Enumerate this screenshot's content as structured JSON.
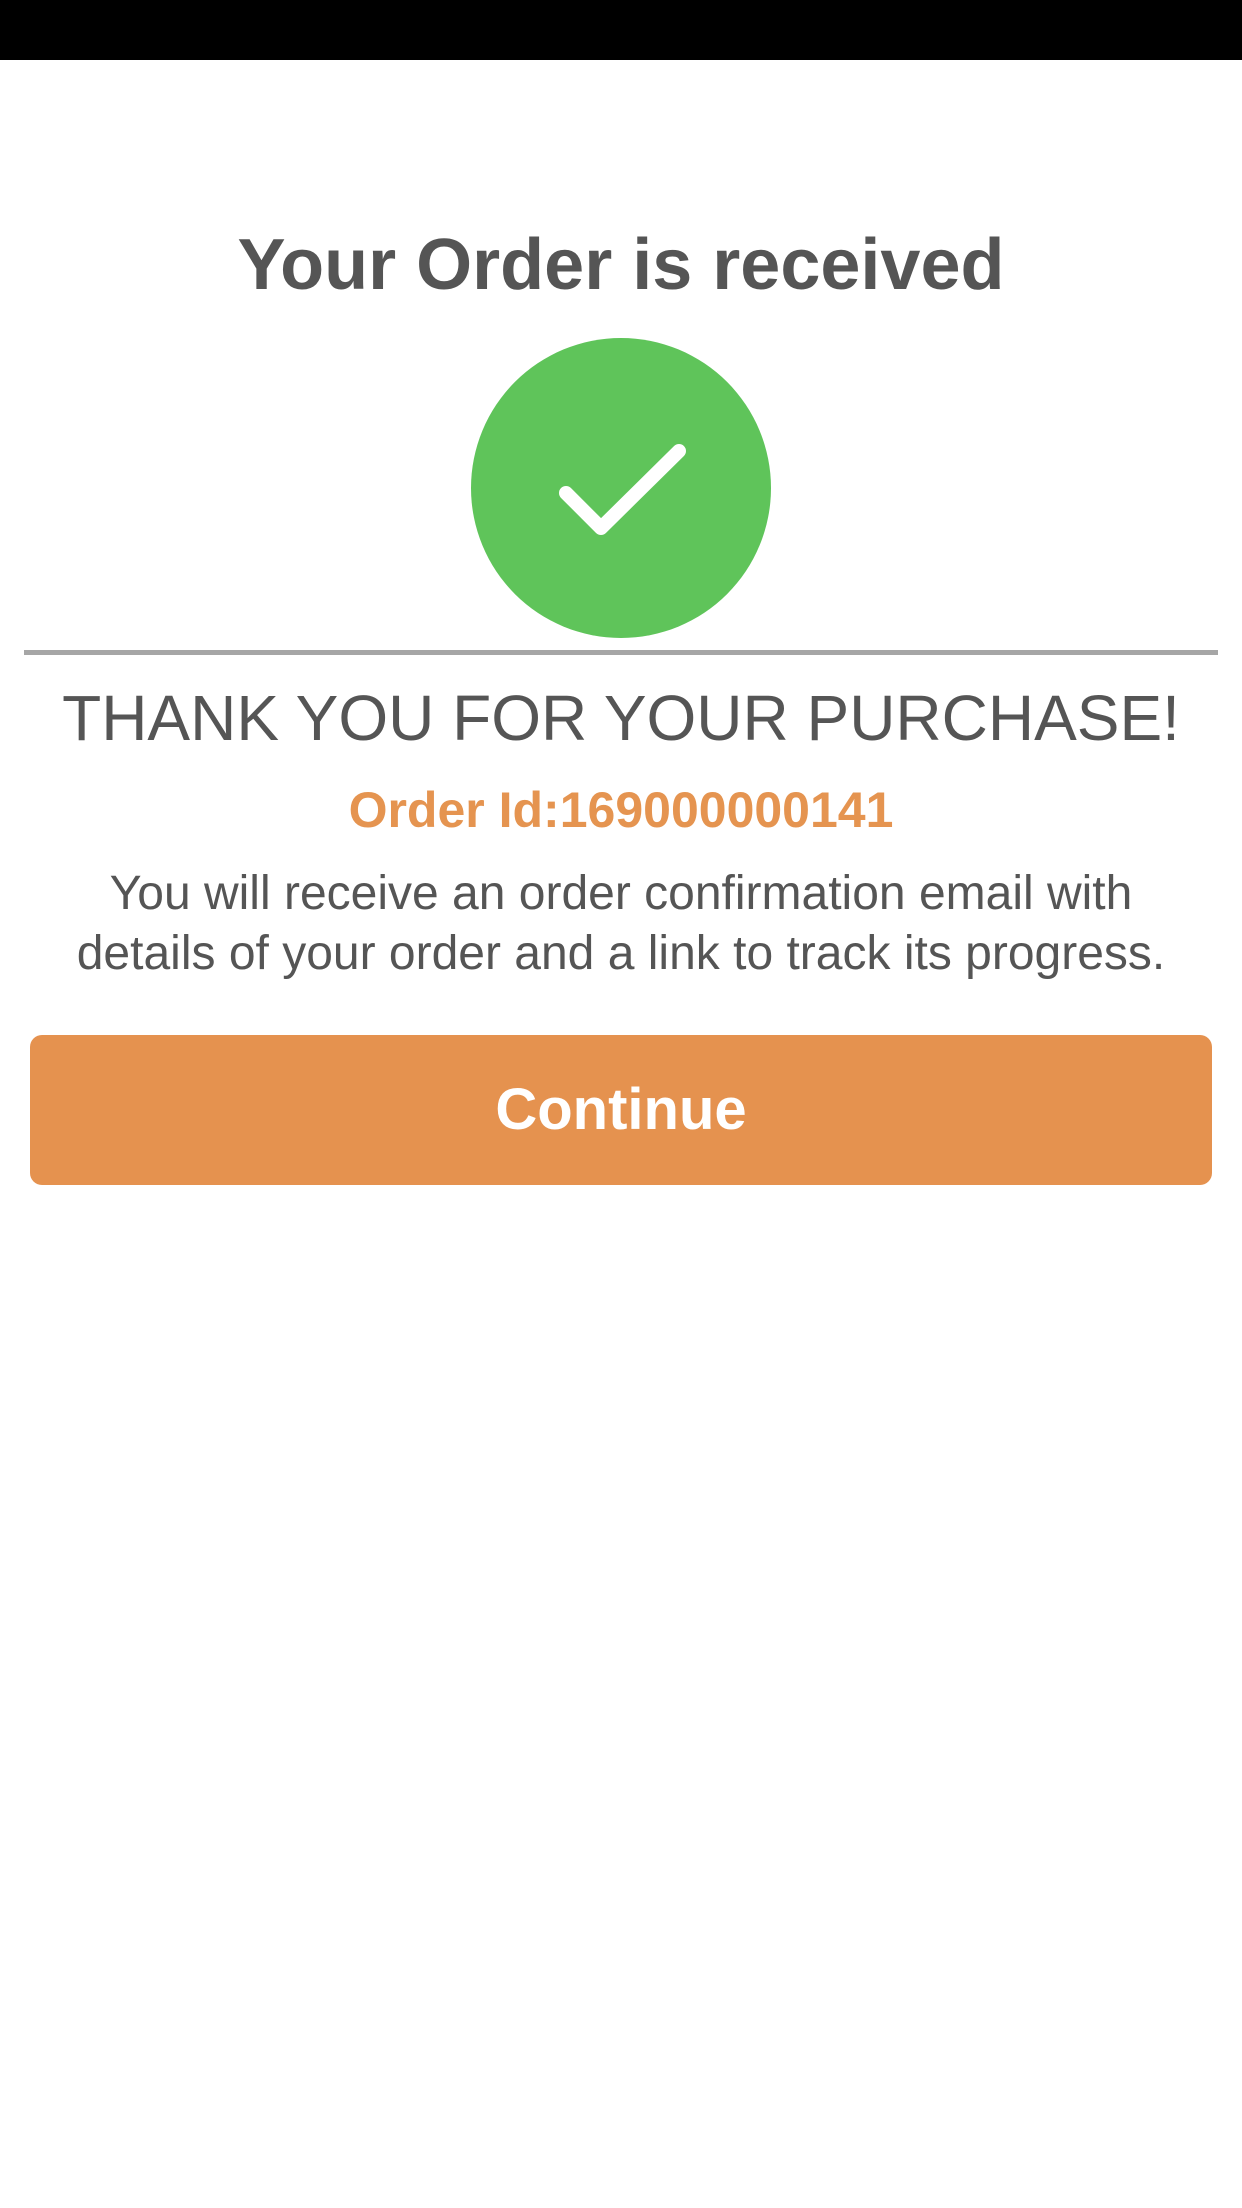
{
  "header": {
    "title": "Your Order is received"
  },
  "status": {
    "icon": "check-circle-icon",
    "color": "#5fc45a"
  },
  "content": {
    "thanks": "THANK YOU FOR YOUR PURCHASE!",
    "order_id_label": "Order Id:",
    "order_id_value": "169000000141",
    "info_line1": "You will receive an order confirmation email with",
    "info_line2": "details of your order and a link to track its progress."
  },
  "actions": {
    "continue_label": "Continue"
  },
  "colors": {
    "accent": "#e5924f",
    "success": "#5fc45a",
    "text": "#555555",
    "status_bar": "#000000"
  }
}
